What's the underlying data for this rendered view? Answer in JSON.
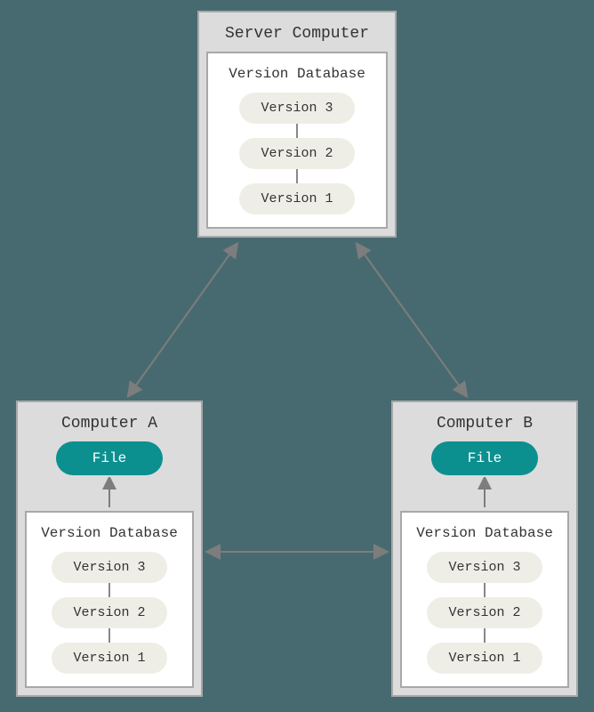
{
  "server": {
    "title": "Server Computer",
    "database": {
      "title": "Version Database",
      "versions": [
        "Version 3",
        "Version 2",
        "Version 1"
      ]
    }
  },
  "computerA": {
    "title": "Computer A",
    "file_label": "File",
    "database": {
      "title": "Version Database",
      "versions": [
        "Version 3",
        "Version 2",
        "Version 1"
      ]
    }
  },
  "computerB": {
    "title": "Computer B",
    "file_label": "File",
    "database": {
      "title": "Version Database",
      "versions": [
        "Version 3",
        "Version 2",
        "Version 1"
      ]
    }
  },
  "colors": {
    "background": "#476a70",
    "box_bg": "#dcdcdc",
    "box_border": "#a8a8a8",
    "file_pill": "#0c8f8f",
    "version_pill": "#efeee6",
    "arrow": "#7d7d7d"
  }
}
